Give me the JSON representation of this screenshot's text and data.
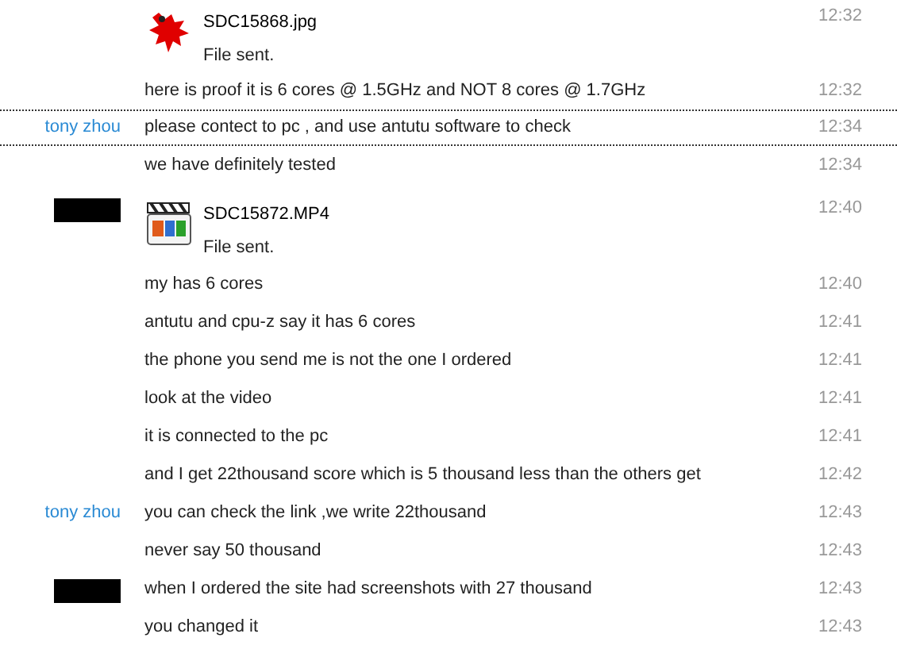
{
  "messages": [
    {
      "kind": "file",
      "file": {
        "kind": "image",
        "name": "SDC15868.jpg",
        "status": "File sent."
      },
      "time": "12:32",
      "highlighted": false
    },
    {
      "kind": "text",
      "text": "here is proof it is 6 cores @ 1.5GHz and NOT 8 cores @ 1.7GHz",
      "time": "12:32",
      "highlighted": false
    },
    {
      "kind": "text",
      "sender": "tony zhou",
      "text": "please contect to pc , and use antutu software to check",
      "time": "12:34",
      "highlighted": true
    },
    {
      "kind": "text",
      "text": "we have definitely tested",
      "time": "12:34",
      "highlighted": false
    },
    {
      "kind": "file",
      "sender_redacted": true,
      "file": {
        "kind": "video",
        "name": "SDC15872.MP4",
        "status": "File sent."
      },
      "time": "12:40",
      "highlighted": false
    },
    {
      "kind": "text",
      "text": "my has 6 cores",
      "time": "12:40",
      "highlighted": false
    },
    {
      "kind": "text",
      "text": "antutu and cpu-z say it has 6 cores",
      "time": "12:41",
      "highlighted": false
    },
    {
      "kind": "text",
      "text": "the phone you send me is not the one I ordered",
      "time": "12:41",
      "highlighted": false
    },
    {
      "kind": "text",
      "text": "look at the video",
      "time": "12:41",
      "highlighted": false
    },
    {
      "kind": "text",
      "text": "it is connected to the pc",
      "time": "12:41",
      "highlighted": false
    },
    {
      "kind": "text",
      "text": "and I get 22thousand score which is 5 thousand less than the others get",
      "time": "12:42",
      "highlighted": false
    },
    {
      "kind": "text",
      "sender": "tony zhou",
      "text": "you can check the link ,we write 22thousand",
      "time": "12:43",
      "highlighted": false
    },
    {
      "kind": "text",
      "text": "never say 50 thousand",
      "time": "12:43",
      "highlighted": false
    },
    {
      "kind": "text",
      "sender_redacted": true,
      "text": "when I ordered the site had screenshots with 27 thousand",
      "time": "12:43",
      "highlighted": false
    },
    {
      "kind": "text",
      "text": "you changed it",
      "time": "12:43",
      "highlighted": false
    }
  ]
}
